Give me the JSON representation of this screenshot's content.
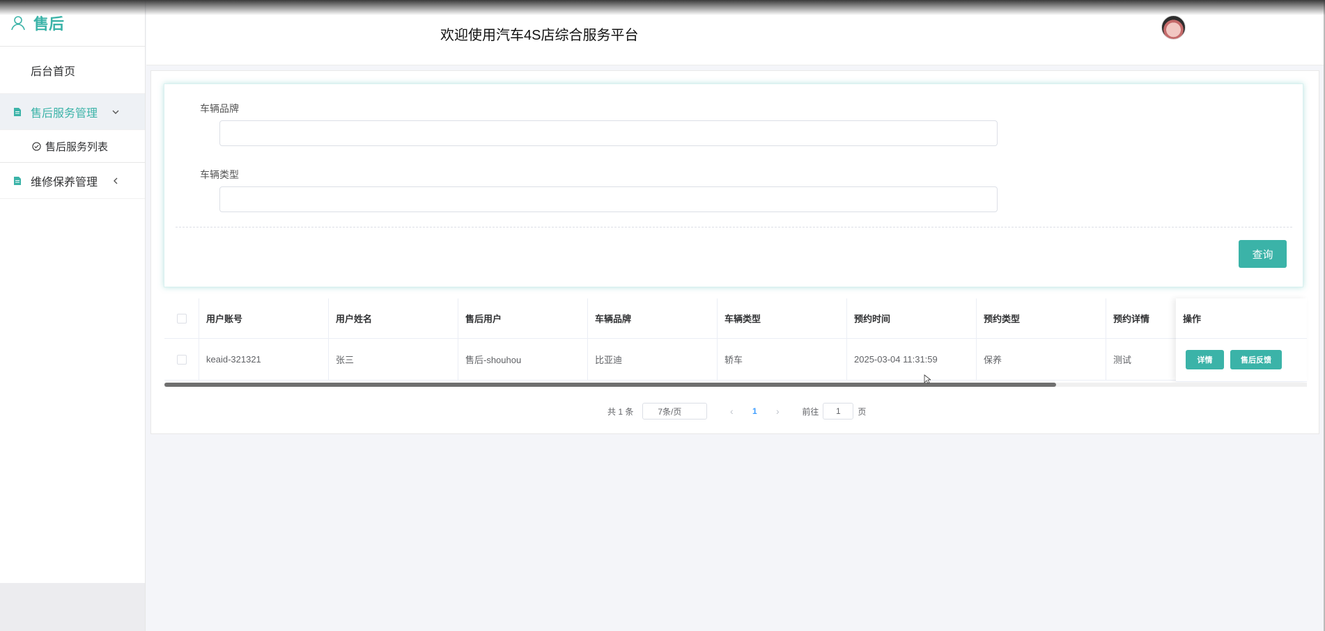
{
  "brand": {
    "title": "售后",
    "accent": "#3bb3a8"
  },
  "header": {
    "title": "欢迎使用汽车4S店综合服务平台"
  },
  "sidebar": {
    "home": "后台首页",
    "groups": [
      {
        "label": "售后服务管理",
        "expanded": true,
        "items": [
          "售后服务列表"
        ]
      },
      {
        "label": "维修保养管理",
        "expanded": false,
        "items": []
      }
    ]
  },
  "search": {
    "brand_label": "车辆品牌",
    "brand_value": "",
    "type_label": "车辆类型",
    "type_value": "",
    "query_label": "查询"
  },
  "table": {
    "columns": [
      "用户账号",
      "用户姓名",
      "售后用户",
      "车辆品牌",
      "车辆类型",
      "预约时间",
      "预约类型",
      "预约详情",
      "操作"
    ],
    "rows": [
      {
        "account": "keaid-321321",
        "name": "张三",
        "after_sales_user": "售后-shouhou",
        "brand": "比亚迪",
        "type": "轿车",
        "time": "2025-03-04 11:31:59",
        "appointment_type": "保养",
        "details": "测试",
        "actions": [
          "详情",
          "售后反馈"
        ]
      }
    ]
  },
  "pagination": {
    "total": "共 1 条",
    "page_size": "7条/页",
    "prev": "‹",
    "current": "1",
    "next": "›",
    "goto_label": "前往",
    "goto_value": "1",
    "goto_suffix": "页"
  }
}
